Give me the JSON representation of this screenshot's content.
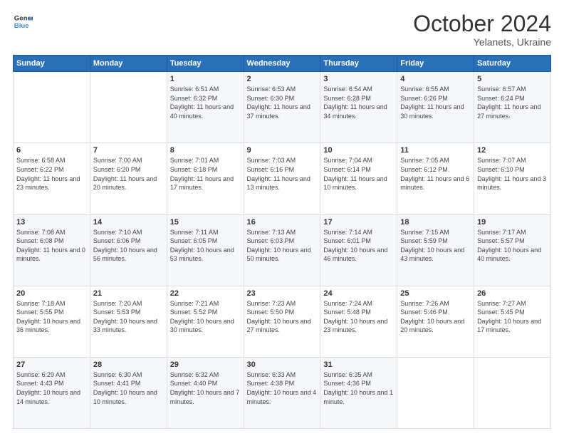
{
  "logo": {
    "line1": "General",
    "line2": "Blue"
  },
  "title": "October 2024",
  "location": "Yelanets, Ukraine",
  "days_header": [
    "Sunday",
    "Monday",
    "Tuesday",
    "Wednesday",
    "Thursday",
    "Friday",
    "Saturday"
  ],
  "weeks": [
    [
      {
        "day": "",
        "sunrise": "",
        "sunset": "",
        "daylight": ""
      },
      {
        "day": "",
        "sunrise": "",
        "sunset": "",
        "daylight": ""
      },
      {
        "day": "1",
        "sunrise": "Sunrise: 6:51 AM",
        "sunset": "Sunset: 6:32 PM",
        "daylight": "Daylight: 11 hours and 40 minutes."
      },
      {
        "day": "2",
        "sunrise": "Sunrise: 6:53 AM",
        "sunset": "Sunset: 6:30 PM",
        "daylight": "Daylight: 11 hours and 37 minutes."
      },
      {
        "day": "3",
        "sunrise": "Sunrise: 6:54 AM",
        "sunset": "Sunset: 6:28 PM",
        "daylight": "Daylight: 11 hours and 34 minutes."
      },
      {
        "day": "4",
        "sunrise": "Sunrise: 6:55 AM",
        "sunset": "Sunset: 6:26 PM",
        "daylight": "Daylight: 11 hours and 30 minutes."
      },
      {
        "day": "5",
        "sunrise": "Sunrise: 6:57 AM",
        "sunset": "Sunset: 6:24 PM",
        "daylight": "Daylight: 11 hours and 27 minutes."
      }
    ],
    [
      {
        "day": "6",
        "sunrise": "Sunrise: 6:58 AM",
        "sunset": "Sunset: 6:22 PM",
        "daylight": "Daylight: 11 hours and 23 minutes."
      },
      {
        "day": "7",
        "sunrise": "Sunrise: 7:00 AM",
        "sunset": "Sunset: 6:20 PM",
        "daylight": "Daylight: 11 hours and 20 minutes."
      },
      {
        "day": "8",
        "sunrise": "Sunrise: 7:01 AM",
        "sunset": "Sunset: 6:18 PM",
        "daylight": "Daylight: 11 hours and 17 minutes."
      },
      {
        "day": "9",
        "sunrise": "Sunrise: 7:03 AM",
        "sunset": "Sunset: 6:16 PM",
        "daylight": "Daylight: 11 hours and 13 minutes."
      },
      {
        "day": "10",
        "sunrise": "Sunrise: 7:04 AM",
        "sunset": "Sunset: 6:14 PM",
        "daylight": "Daylight: 11 hours and 10 minutes."
      },
      {
        "day": "11",
        "sunrise": "Sunrise: 7:05 AM",
        "sunset": "Sunset: 6:12 PM",
        "daylight": "Daylight: 11 hours and 6 minutes."
      },
      {
        "day": "12",
        "sunrise": "Sunrise: 7:07 AM",
        "sunset": "Sunset: 6:10 PM",
        "daylight": "Daylight: 11 hours and 3 minutes."
      }
    ],
    [
      {
        "day": "13",
        "sunrise": "Sunrise: 7:08 AM",
        "sunset": "Sunset: 6:08 PM",
        "daylight": "Daylight: 11 hours and 0 minutes."
      },
      {
        "day": "14",
        "sunrise": "Sunrise: 7:10 AM",
        "sunset": "Sunset: 6:06 PM",
        "daylight": "Daylight: 10 hours and 56 minutes."
      },
      {
        "day": "15",
        "sunrise": "Sunrise: 7:11 AM",
        "sunset": "Sunset: 6:05 PM",
        "daylight": "Daylight: 10 hours and 53 minutes."
      },
      {
        "day": "16",
        "sunrise": "Sunrise: 7:13 AM",
        "sunset": "Sunset: 6:03 PM",
        "daylight": "Daylight: 10 hours and 50 minutes."
      },
      {
        "day": "17",
        "sunrise": "Sunrise: 7:14 AM",
        "sunset": "Sunset: 6:01 PM",
        "daylight": "Daylight: 10 hours and 46 minutes."
      },
      {
        "day": "18",
        "sunrise": "Sunrise: 7:15 AM",
        "sunset": "Sunset: 5:59 PM",
        "daylight": "Daylight: 10 hours and 43 minutes."
      },
      {
        "day": "19",
        "sunrise": "Sunrise: 7:17 AM",
        "sunset": "Sunset: 5:57 PM",
        "daylight": "Daylight: 10 hours and 40 minutes."
      }
    ],
    [
      {
        "day": "20",
        "sunrise": "Sunrise: 7:18 AM",
        "sunset": "Sunset: 5:55 PM",
        "daylight": "Daylight: 10 hours and 36 minutes."
      },
      {
        "day": "21",
        "sunrise": "Sunrise: 7:20 AM",
        "sunset": "Sunset: 5:53 PM",
        "daylight": "Daylight: 10 hours and 33 minutes."
      },
      {
        "day": "22",
        "sunrise": "Sunrise: 7:21 AM",
        "sunset": "Sunset: 5:52 PM",
        "daylight": "Daylight: 10 hours and 30 minutes."
      },
      {
        "day": "23",
        "sunrise": "Sunrise: 7:23 AM",
        "sunset": "Sunset: 5:50 PM",
        "daylight": "Daylight: 10 hours and 27 minutes."
      },
      {
        "day": "24",
        "sunrise": "Sunrise: 7:24 AM",
        "sunset": "Sunset: 5:48 PM",
        "daylight": "Daylight: 10 hours and 23 minutes."
      },
      {
        "day": "25",
        "sunrise": "Sunrise: 7:26 AM",
        "sunset": "Sunset: 5:46 PM",
        "daylight": "Daylight: 10 hours and 20 minutes."
      },
      {
        "day": "26",
        "sunrise": "Sunrise: 7:27 AM",
        "sunset": "Sunset: 5:45 PM",
        "daylight": "Daylight: 10 hours and 17 minutes."
      }
    ],
    [
      {
        "day": "27",
        "sunrise": "Sunrise: 6:29 AM",
        "sunset": "Sunset: 4:43 PM",
        "daylight": "Daylight: 10 hours and 14 minutes."
      },
      {
        "day": "28",
        "sunrise": "Sunrise: 6:30 AM",
        "sunset": "Sunset: 4:41 PM",
        "daylight": "Daylight: 10 hours and 10 minutes."
      },
      {
        "day": "29",
        "sunrise": "Sunrise: 6:32 AM",
        "sunset": "Sunset: 4:40 PM",
        "daylight": "Daylight: 10 hours and 7 minutes."
      },
      {
        "day": "30",
        "sunrise": "Sunrise: 6:33 AM",
        "sunset": "Sunset: 4:38 PM",
        "daylight": "Daylight: 10 hours and 4 minutes."
      },
      {
        "day": "31",
        "sunrise": "Sunrise: 6:35 AM",
        "sunset": "Sunset: 4:36 PM",
        "daylight": "Daylight: 10 hours and 1 minute."
      },
      {
        "day": "",
        "sunrise": "",
        "sunset": "",
        "daylight": ""
      },
      {
        "day": "",
        "sunrise": "",
        "sunset": "",
        "daylight": ""
      }
    ]
  ]
}
